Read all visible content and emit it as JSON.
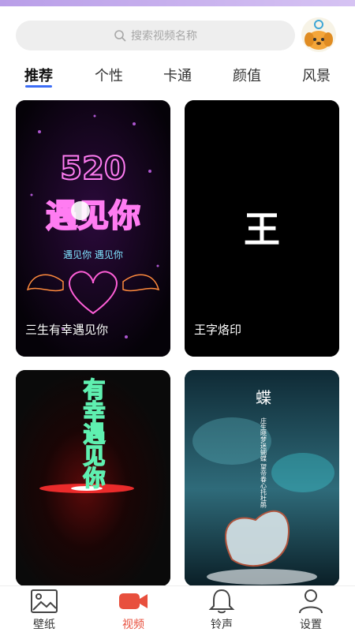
{
  "search": {
    "placeholder": "搜索视频名称"
  },
  "tabs": [
    {
      "label": "推荐"
    },
    {
      "label": "个性"
    },
    {
      "label": "卡通"
    },
    {
      "label": "颜值"
    },
    {
      "label": "风景"
    }
  ],
  "cards": [
    {
      "title": "三生有幸遇见你",
      "art_text_1": "520",
      "art_text_2": "遇见你",
      "art_text_3": "遇见你 遇见你"
    },
    {
      "title": "王字烙印",
      "art_text": "王"
    },
    {
      "title": "",
      "art_text": "有幸遇见你"
    },
    {
      "title": "",
      "art_title": "蝶",
      "art_poem": "庄生晓梦迷蝴蝶 望帝春心托杜鹃"
    }
  ],
  "bottom_nav": [
    {
      "label": "壁纸",
      "icon": "image-icon"
    },
    {
      "label": "视频",
      "icon": "video-icon"
    },
    {
      "label": "铃声",
      "icon": "bell-icon"
    },
    {
      "label": "设置",
      "icon": "person-icon"
    }
  ],
  "colors": {
    "accent": "#3b6cf6",
    "active_nav": "#e84f3d"
  }
}
